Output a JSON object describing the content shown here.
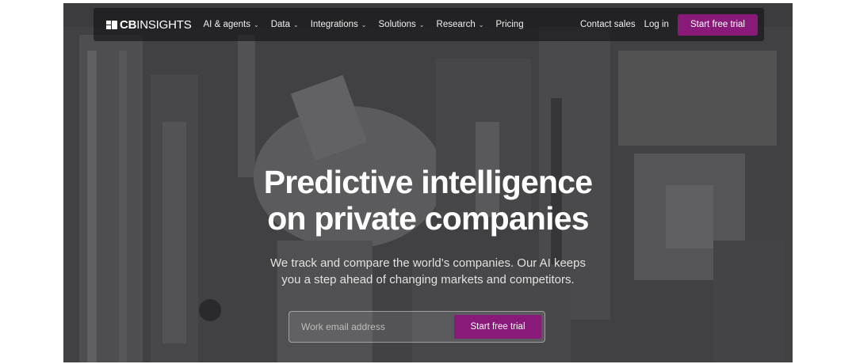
{
  "brand": {
    "bold": "CB",
    "light": "INSIGHTS"
  },
  "nav": {
    "items": [
      {
        "label": "AI & agents",
        "has_dropdown": true
      },
      {
        "label": "Data",
        "has_dropdown": true
      },
      {
        "label": "Integrations",
        "has_dropdown": true
      },
      {
        "label": "Solutions",
        "has_dropdown": true
      },
      {
        "label": "Research",
        "has_dropdown": true
      },
      {
        "label": "Pricing",
        "has_dropdown": false
      }
    ],
    "chevron": "⌄",
    "contact": "Contact sales",
    "login": "Log in",
    "cta": "Start free trial"
  },
  "hero": {
    "title_line1": "Predictive intelligence",
    "title_line2": "on private companies",
    "subtitle_line1": "We track and compare the world’s companies. Our AI keeps",
    "subtitle_line2": "you a step ahead of changing markets and competitors."
  },
  "form": {
    "placeholder": "Work email address",
    "button": "Start free trial"
  },
  "colors": {
    "accent": "#8a1a7a",
    "nav_bg": "#141416",
    "overlay": "#3f3f40"
  },
  "icons": {
    "logo": "cb-insights-logo-icon",
    "dropdown": "chevron-down-icon"
  }
}
